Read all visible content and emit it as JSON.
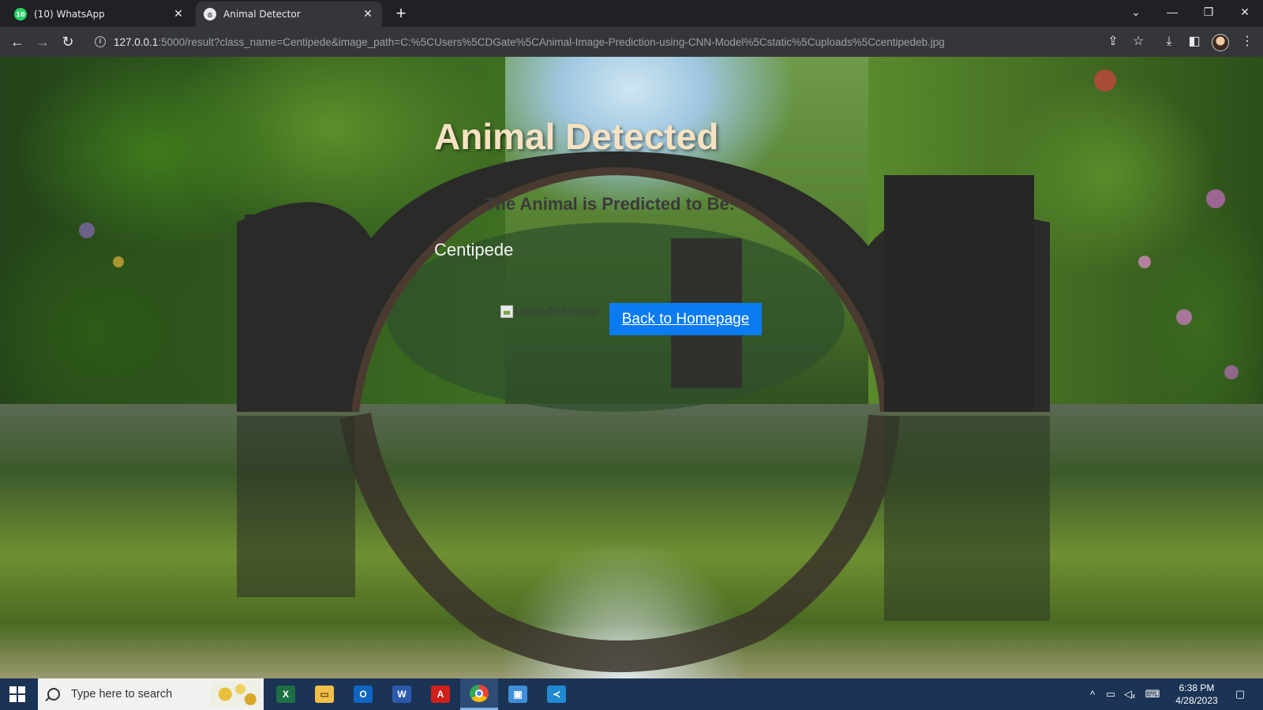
{
  "browser": {
    "tabs": [
      {
        "title": "(10) WhatsApp",
        "badge": "10",
        "icon": "whatsapp-icon",
        "active": false
      },
      {
        "title": "Animal Detector",
        "icon": "globe-icon",
        "active": true
      }
    ],
    "url_host": "127.0.0.1",
    "url_rest": ":5000/result?class_name=Centipede&image_path=C:%5CUsers%5CDGate%5CAnimal-Image-Prediction-using-CNN-Model%5Cstatic%5Cuploads%5Ccentipedeb.jpg"
  },
  "page": {
    "title": "Animal Detected",
    "prediction_label": "The Animal is Predicted to Be:",
    "prediction_value": "Centipede",
    "image_alt": "Uploaded Image",
    "home_button": "Back to Homepage",
    "button_color": "#0a7bf3"
  },
  "taskbar": {
    "search_placeholder": "Type here to search",
    "apps": [
      "excel",
      "file-explorer",
      "outlook",
      "word",
      "acrobat",
      "chrome",
      "remote-desktop",
      "vscode"
    ],
    "time": "6:38 PM",
    "date": "4/28/2023"
  }
}
